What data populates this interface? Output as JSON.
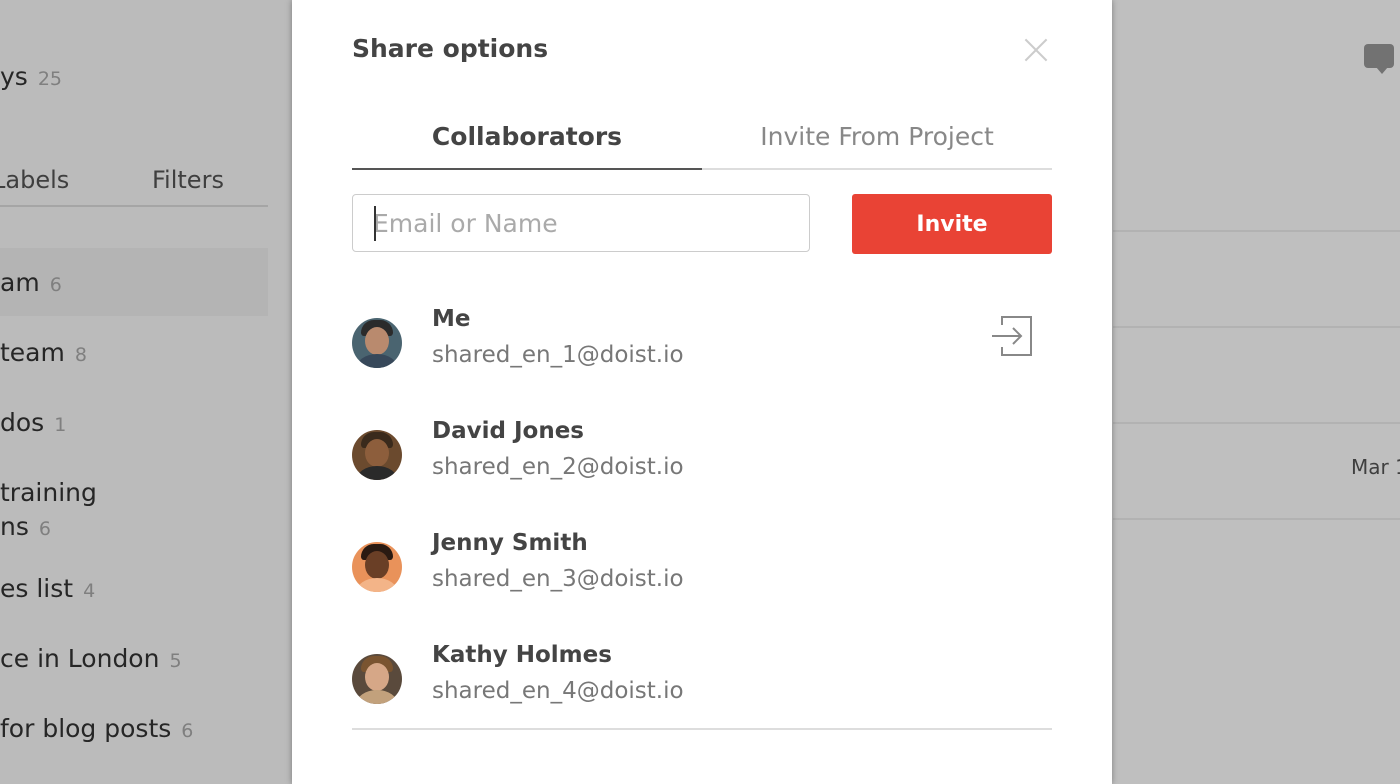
{
  "background": {
    "sidebar": {
      "header": {
        "label": "ys",
        "count": "25"
      },
      "tabs": {
        "labels": "Labels",
        "filters": "Filters"
      },
      "projects": [
        {
          "label": "am",
          "count": "6"
        },
        {
          "label": "team",
          "count": "8"
        },
        {
          "label": "dos",
          "count": "1"
        },
        {
          "label": "training",
          "label2": "ns",
          "count": "6"
        },
        {
          "label": "es list",
          "count": "4"
        },
        {
          "label": "ce in London",
          "count": "5"
        },
        {
          "label": "for blog posts",
          "count": "6"
        }
      ]
    },
    "main": {
      "date_label": "Mar 1"
    }
  },
  "modal": {
    "title": "Share options",
    "tabs": {
      "collaborators": "Collaborators",
      "invite_from_project": "Invite From Project"
    },
    "input": {
      "placeholder": "Email or Name",
      "value": ""
    },
    "invite_label": "Invite",
    "collaborators": [
      {
        "name": "Me",
        "email": "shared_en_1@doist.io"
      },
      {
        "name": "David Jones",
        "email": "shared_en_2@doist.io"
      },
      {
        "name": "Jenny Smith",
        "email": "shared_en_3@doist.io"
      },
      {
        "name": "Kathy Holmes",
        "email": "shared_en_4@doist.io"
      }
    ]
  },
  "icons": {
    "close": "close-icon",
    "leave": "leave-project-icon",
    "comment": "comment-icon"
  }
}
